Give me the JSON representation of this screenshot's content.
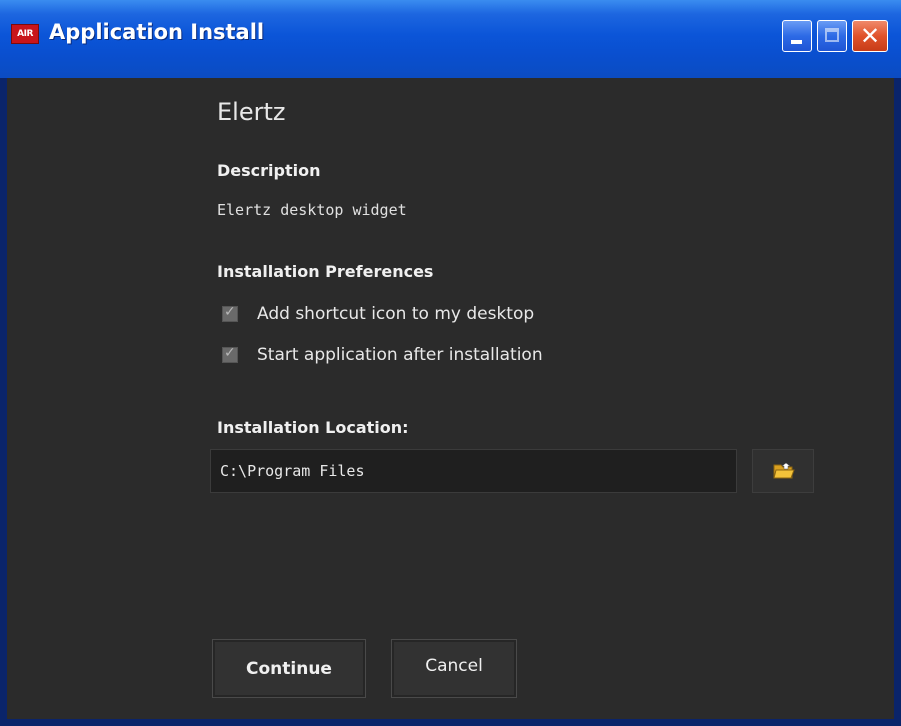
{
  "window": {
    "title": "Application Install",
    "app_icon_text": "AIR"
  },
  "titlebar_buttons": {
    "close_glyph": "✕"
  },
  "app": {
    "name": "Elertz"
  },
  "description": {
    "label": "Description",
    "text": "Elertz desktop widget"
  },
  "preferences": {
    "label": "Installation Preferences",
    "options": [
      {
        "label": "Add shortcut icon to my desktop",
        "checked": true
      },
      {
        "label": "Start application after installation",
        "checked": true
      }
    ]
  },
  "location": {
    "label": "Installation Location:",
    "value": "C:\\Program Files",
    "browse_icon": "folder-open-icon"
  },
  "buttons": {
    "continue_label": "Continue",
    "cancel_label": "Cancel"
  },
  "colors": {
    "titlebar_blue": "#0b55d8",
    "close_red": "#e0532b",
    "panel_bg": "#2b2b2b",
    "folder_yellow": "#f2c23a"
  }
}
